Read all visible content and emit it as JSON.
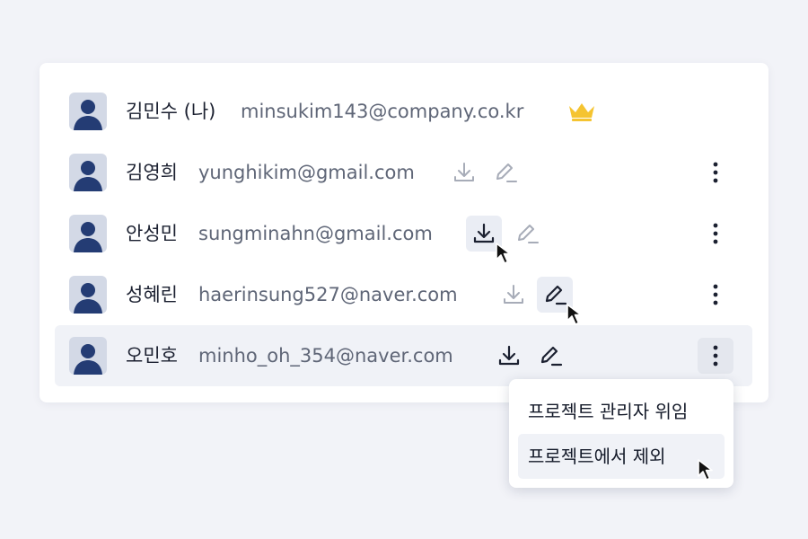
{
  "members": [
    {
      "name": "김민수 (나)",
      "email": "minsukim143@company.co.kr",
      "is_owner": true,
      "badge_icon": "crown-icon"
    },
    {
      "name": "김영희",
      "email": "yunghikim@gmail.com",
      "is_owner": false
    },
    {
      "name": "안성민",
      "email": "sungminahn@gmail.com",
      "is_owner": false
    },
    {
      "name": "성혜린",
      "email": "haerinsung527@naver.com",
      "is_owner": false
    },
    {
      "name": "오민호",
      "email": "minho_oh_354@naver.com",
      "is_owner": false
    }
  ],
  "icons": {
    "download": "download-icon",
    "edit": "pencil-icon",
    "more": "more-vertical-icon",
    "avatar": "user-avatar-icon",
    "cursor": "mouse-pointer-icon"
  },
  "context_menu": {
    "items": [
      {
        "label": "프로젝트 관리자 위임"
      },
      {
        "label": "프로젝트에서 제외"
      }
    ]
  },
  "colors": {
    "background": "#f2f3f8",
    "card": "#ffffff",
    "avatar_bg": "#d3d9e6",
    "avatar_fg": "#243c74",
    "crown": "#f5c431",
    "text_primary": "#1b2030",
    "text_secondary": "#5f6677",
    "icon_muted": "#a7acb8",
    "icon_active": "#1b2030",
    "row_hover": "#f0f2f7"
  }
}
